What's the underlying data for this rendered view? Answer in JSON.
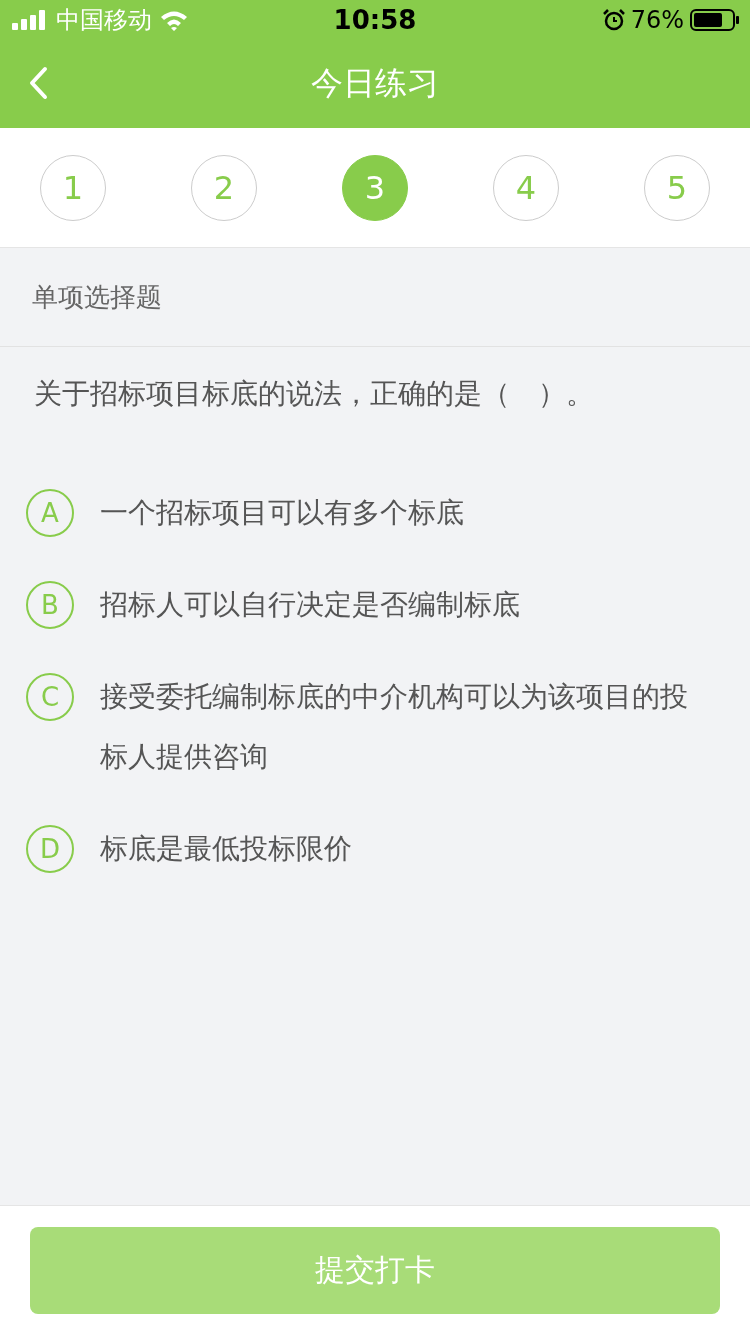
{
  "status_bar": {
    "carrier": "中国移动",
    "time": "10:58",
    "battery": "76%"
  },
  "nav_bar": {
    "title": "今日练习"
  },
  "question_numbers": [
    {
      "label": "1",
      "selected": false
    },
    {
      "label": "2",
      "selected": false
    },
    {
      "label": "3",
      "selected": true
    },
    {
      "label": "4",
      "selected": false
    },
    {
      "label": "5",
      "selected": false
    }
  ],
  "section_title": "单项选择题",
  "question": "关于招标项目标底的说法，正确的是（　）。",
  "options": [
    {
      "letter": "A",
      "text": "一个招标项目可以有多个标底",
      "selected": false
    },
    {
      "letter": "B",
      "text": "招标人可以自行决定是否编制标底",
      "selected": false
    },
    {
      "letter": "C",
      "text": "接受委托编制标底的中介机构可以为该项目的投标人提供咨询",
      "selected": false
    },
    {
      "letter": "D",
      "text": "标底是最低投标限价",
      "selected": false
    }
  ],
  "submit_button": {
    "label": "提交打卡",
    "disabled": true
  }
}
